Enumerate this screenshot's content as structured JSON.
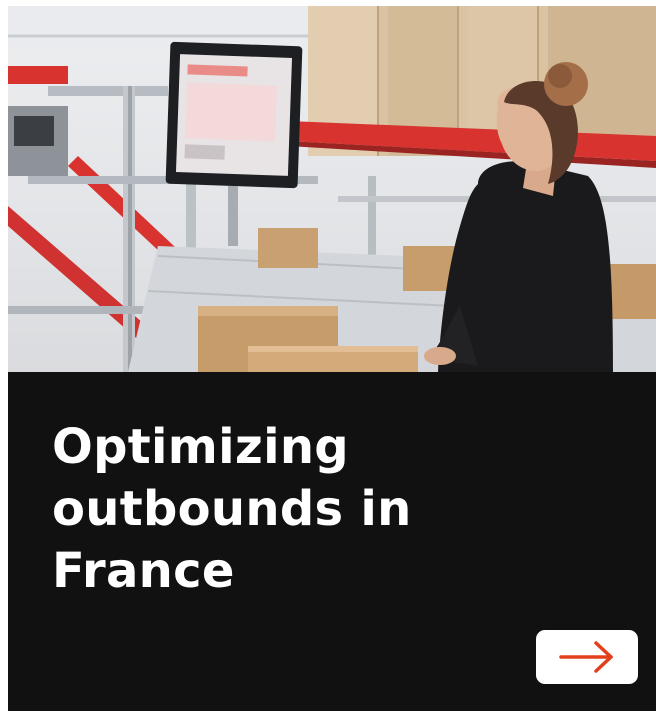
{
  "card": {
    "headline_lines": [
      "Optimizing",
      "outbounds in",
      "France"
    ],
    "photo_subject": "warehouse-worker-at-conveyor-screen",
    "cta_icon": "arrow-right-icon"
  },
  "colors": {
    "panel_background": "#111111",
    "headline_text": "#ffffff",
    "cta_background": "#ffffff",
    "cta_arrow": "#e2401c",
    "photo_accent_red": "#d8332f"
  }
}
